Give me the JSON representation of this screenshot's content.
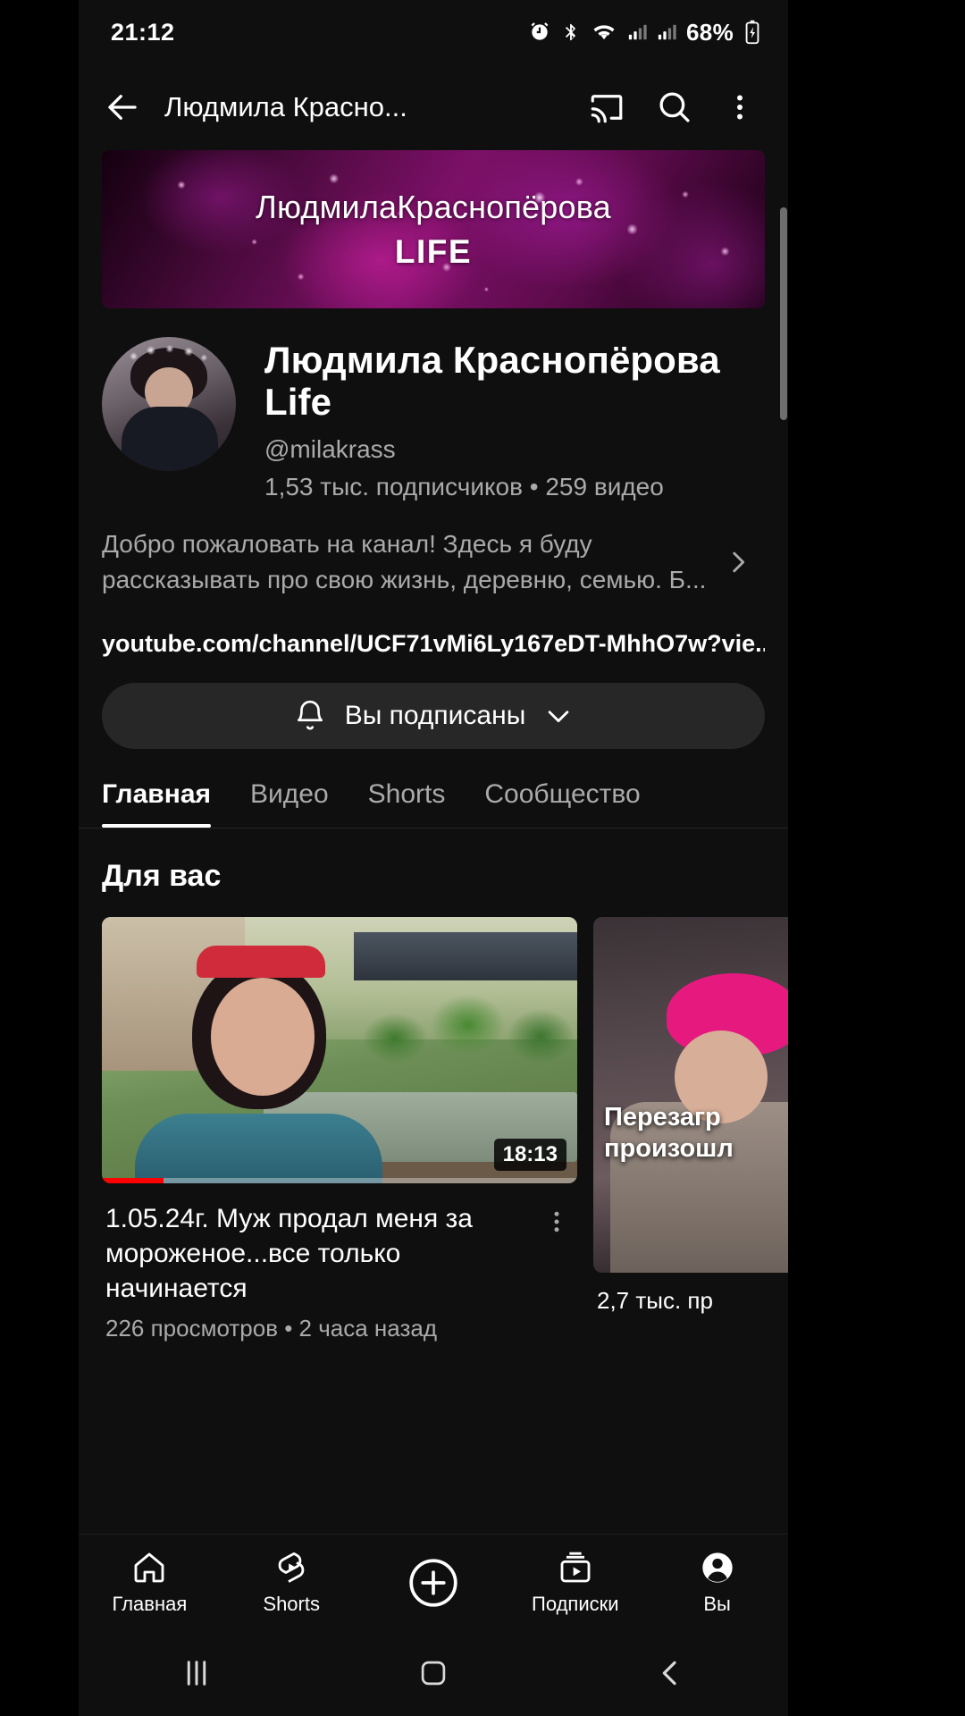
{
  "status_bar": {
    "time": "21:12",
    "battery": "68%",
    "icons": [
      "alarm-icon",
      "bluetooth-icon",
      "wifi-icon",
      "signal-icon-1",
      "signal-icon-2",
      "battery-icon"
    ]
  },
  "app_bar": {
    "back": "back-arrow-icon",
    "title": "Людмила Красно...",
    "cast": "cast-icon",
    "search": "search-icon",
    "more": "more-vertical-icon"
  },
  "banner": {
    "line1": "ЛюдмилаКраснопёрова",
    "line2": "LIFE"
  },
  "channel": {
    "name": "Людмила Краснопёрова Life",
    "handle": "@milakrass",
    "stats": "1,53 тыс. подписчиков • 259 видео",
    "description": "Добро пожаловать на  канал! Здесь я буду рассказывать про свою жизнь, деревню, семью. Б...",
    "url": "youtube.com/channel/UCF71vMi6Ly167eDT-MhhO7w?vie...",
    "subscribe_label": "Вы подписаны",
    "bell_icon": "bell-icon",
    "chevron_icon": "chevron-down-icon",
    "expand_icon": "chevron-right-icon"
  },
  "tabs": [
    {
      "label": "Главная",
      "active": true
    },
    {
      "label": "Видео",
      "active": false
    },
    {
      "label": "Shorts",
      "active": false
    },
    {
      "label": "Сообщество",
      "active": false
    }
  ],
  "shelf": {
    "title": "Для вас",
    "videos": [
      {
        "duration": "18:13",
        "title": "1.05.24г. Муж продал меня за мороженое...все только начинается",
        "subtitle": "226 просмотров • 2 часа назад",
        "menu_icon": "more-vertical-icon"
      },
      {
        "overlay_title": "Перезагр произошл",
        "caption": "2,7 тыс. пр"
      }
    ]
  },
  "bottom_nav": [
    {
      "label": "Главная",
      "icon": "home-icon"
    },
    {
      "label": "Shorts",
      "icon": "shorts-icon"
    },
    {
      "label": "",
      "icon": "create-plus-icon"
    },
    {
      "label": "Подписки",
      "icon": "subscriptions-icon"
    },
    {
      "label": "Вы",
      "icon": "account-icon"
    }
  ],
  "system_nav": {
    "recents": "recents-icon",
    "home": "home-square-icon",
    "back": "back-chevron-icon"
  },
  "colors": {
    "background": "#0f0f0f",
    "accent_red": "#ff0000",
    "text_primary": "#ffffff",
    "text_secondary": "#aaaaaa",
    "chip_bg": "#272727"
  }
}
